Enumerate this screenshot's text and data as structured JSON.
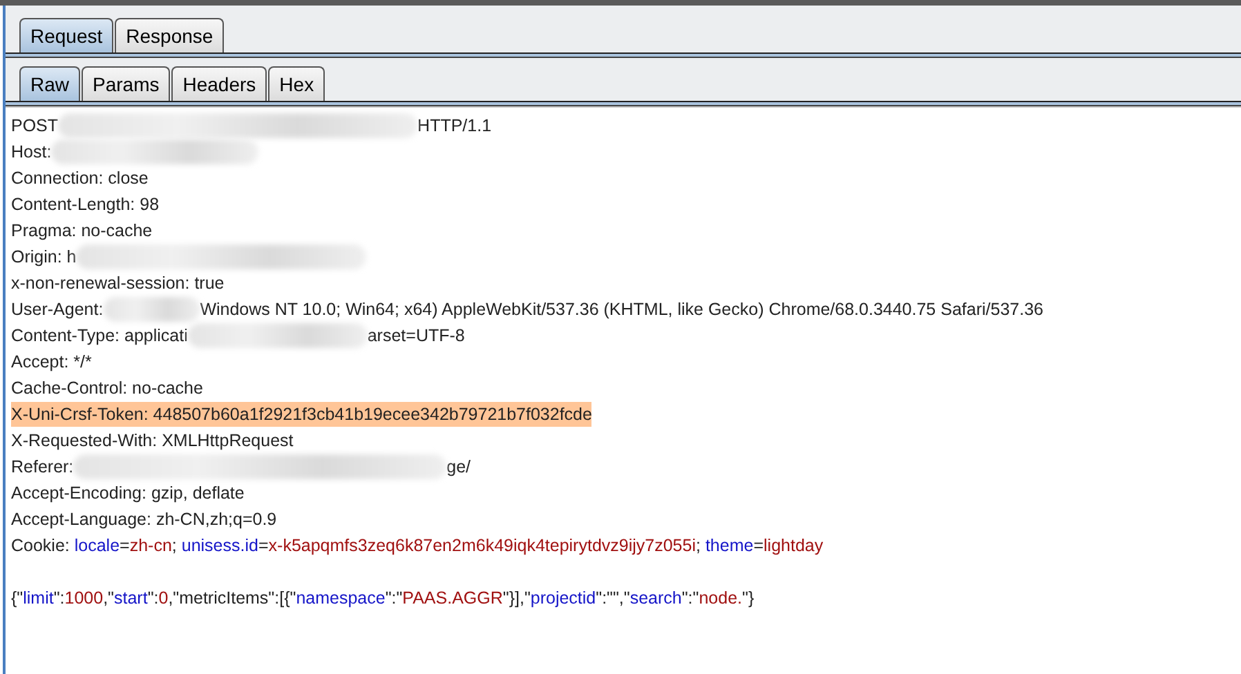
{
  "tabs": [
    {
      "label": "Request",
      "selected": true
    },
    {
      "label": "Response",
      "selected": false
    }
  ],
  "subtabs": [
    {
      "label": "Raw",
      "selected": true
    },
    {
      "label": "Params",
      "selected": false
    },
    {
      "label": "Headers",
      "selected": false
    },
    {
      "label": "Hex",
      "selected": false
    }
  ],
  "lines": [
    {
      "highlighted": false,
      "segments": [
        {
          "kind": "plain",
          "text": "POST"
        },
        {
          "kind": "redacted"
        },
        {
          "kind": "plain",
          "text": "HTTP/1.1"
        }
      ]
    },
    {
      "highlighted": false,
      "segments": [
        {
          "kind": "plain",
          "text": "Host:"
        },
        {
          "kind": "redacted"
        }
      ]
    },
    {
      "highlighted": false,
      "segments": [
        {
          "kind": "plain",
          "text": "Connection: close"
        }
      ]
    },
    {
      "highlighted": false,
      "segments": [
        {
          "kind": "plain",
          "text": "Content-Length: 98"
        }
      ]
    },
    {
      "highlighted": false,
      "segments": [
        {
          "kind": "plain",
          "text": "Pragma: no-cache"
        }
      ]
    },
    {
      "highlighted": false,
      "segments": [
        {
          "kind": "plain",
          "text": "Origin: h"
        },
        {
          "kind": "redacted"
        }
      ]
    },
    {
      "highlighted": false,
      "segments": [
        {
          "kind": "plain",
          "text": "x-non-renewal-session: true"
        }
      ]
    },
    {
      "highlighted": false,
      "segments": [
        {
          "kind": "plain",
          "text": "User-Agent:"
        },
        {
          "kind": "redacted"
        },
        {
          "kind": "plain",
          "text": "Windows NT 10.0; Win64; x64) AppleWebKit/537.36 (KHTML, like Gecko) Chrome/68.0.3440.75 Safari/537.36"
        }
      ]
    },
    {
      "highlighted": false,
      "segments": [
        {
          "kind": "plain",
          "text": "Content-Type: applicati"
        },
        {
          "kind": "redacted"
        },
        {
          "kind": "plain",
          "text": "arset=UTF-8"
        }
      ]
    },
    {
      "highlighted": false,
      "segments": [
        {
          "kind": "plain",
          "text": "Accept: */*"
        }
      ]
    },
    {
      "highlighted": false,
      "segments": [
        {
          "kind": "plain",
          "text": "Cache-Control: no-cache"
        }
      ]
    },
    {
      "highlighted": true,
      "segments": [
        {
          "kind": "plain",
          "text": "X-Uni-Crsf-Token: 448507b60a1f2921f3cb41b19ecee342b79721b7f032fcde"
        }
      ]
    },
    {
      "highlighted": false,
      "segments": [
        {
          "kind": "plain",
          "text": "X-Requested-With: XMLHttpRequest"
        }
      ]
    },
    {
      "highlighted": false,
      "segments": [
        {
          "kind": "plain",
          "text": "Referer:"
        },
        {
          "kind": "redacted"
        },
        {
          "kind": "plain",
          "text": "ge/"
        }
      ]
    },
    {
      "highlighted": false,
      "segments": [
        {
          "kind": "plain",
          "text": "Accept-Encoding: gzip, deflate"
        }
      ]
    },
    {
      "highlighted": false,
      "segments": [
        {
          "kind": "plain",
          "text": "Accept-Language: zh-CN,zh;q=0.9"
        }
      ]
    },
    {
      "highlighted": false,
      "segments": [
        {
          "kind": "plain",
          "text": "Cookie: "
        },
        {
          "kind": "name",
          "text": "locale"
        },
        {
          "kind": "plain",
          "text": "="
        },
        {
          "kind": "value",
          "text": "zh-cn"
        },
        {
          "kind": "plain",
          "text": "; "
        },
        {
          "kind": "name",
          "text": "unisess.id"
        },
        {
          "kind": "plain",
          "text": "="
        },
        {
          "kind": "value",
          "text": "x-k5apqmfs3zeq6k87en2m6k49iqk4tepirytdvz9ijy7z055i"
        },
        {
          "kind": "plain",
          "text": "; "
        },
        {
          "kind": "name",
          "text": "theme"
        },
        {
          "kind": "plain",
          "text": "="
        },
        {
          "kind": "value",
          "text": "lightday"
        }
      ]
    },
    {
      "highlighted": false
    },
    {
      "highlighted": false,
      "segments": [
        {
          "kind": "plain",
          "text": "{\""
        },
        {
          "kind": "name",
          "text": "limit"
        },
        {
          "kind": "plain",
          "text": "\":"
        },
        {
          "kind": "value",
          "text": "1000"
        },
        {
          "kind": "plain",
          "text": ",\""
        },
        {
          "kind": "name",
          "text": "start"
        },
        {
          "kind": "plain",
          "text": "\":"
        },
        {
          "kind": "value",
          "text": "0"
        },
        {
          "kind": "plain",
          "text": ",\"metricItems\":[{\""
        },
        {
          "kind": "name",
          "text": "namespace"
        },
        {
          "kind": "plain",
          "text": "\":\""
        },
        {
          "kind": "value",
          "text": "PAAS.AGGR"
        },
        {
          "kind": "plain",
          "text": "\"}],\""
        },
        {
          "kind": "name",
          "text": "projectid"
        },
        {
          "kind": "plain",
          "text": "\":\"\",\""
        },
        {
          "kind": "name",
          "text": "search"
        },
        {
          "kind": "plain",
          "text": "\":\""
        },
        {
          "kind": "value",
          "text": "node."
        },
        {
          "kind": "plain",
          "text": "\"}"
        }
      ]
    }
  ]
}
